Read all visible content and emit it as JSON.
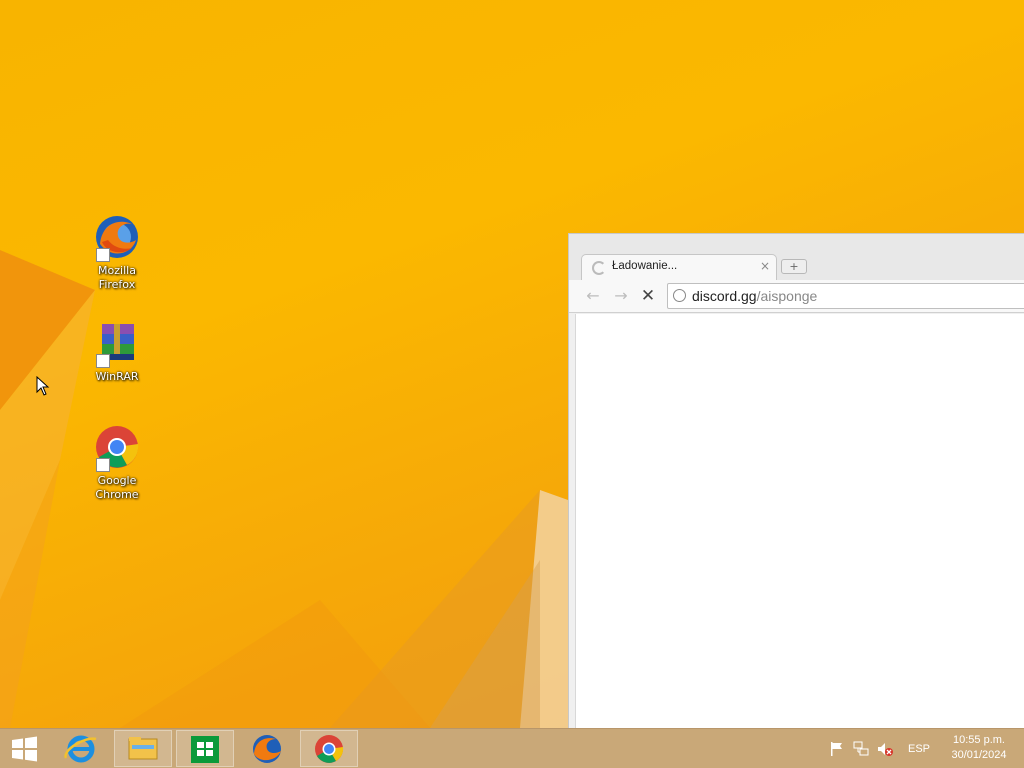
{
  "desktop": {
    "icons": [
      {
        "label": "Mozilla\nFirefox"
      },
      {
        "label": "WinRAR"
      },
      {
        "label": "Google\nChrome"
      }
    ]
  },
  "browser": {
    "tab_title": "Ładowanie...",
    "tab_close": "×",
    "new_tab": "+",
    "back": "←",
    "forward": "→",
    "stop": "✕",
    "url_host": "discord.gg",
    "url_path": "/aisponge"
  },
  "taskbar": {
    "pinned": [
      "internet-explorer",
      "file-explorer",
      "store",
      "firefox",
      "chrome"
    ],
    "tray": {
      "language": "ESP",
      "time": "10:55 p.m.",
      "date": "30/01/2024"
    }
  },
  "colors": {
    "wallpaper": "#f8b400",
    "taskbar": "#c9a878"
  }
}
